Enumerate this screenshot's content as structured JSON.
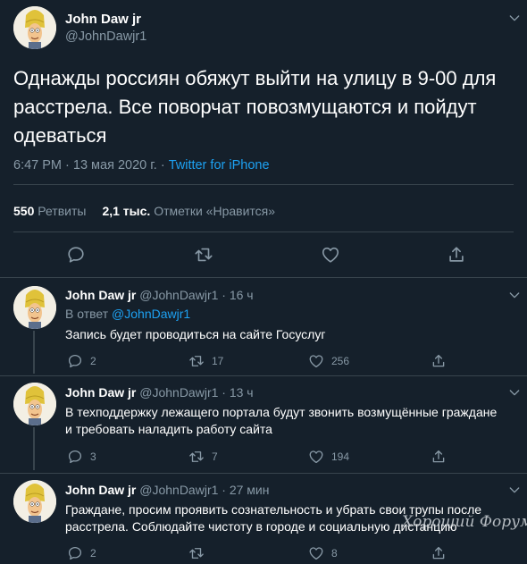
{
  "main": {
    "name": "John Daw jr",
    "handle": "@JohnDawjr1",
    "text": "Однажды россиян обяжут выйти на улицу в 9-00 для расстрела. Все поворчат повозмущаются и пойдут одеваться",
    "time": "6:47 PM · 13 мая 2020 г. · ",
    "source": "Twitter for iPhone",
    "retweets_count": "550",
    "retweets_label": "Ретвиты",
    "likes_count": "2,1 тыс.",
    "likes_label": "Отметки «Нравится»"
  },
  "replies": [
    {
      "name": "John Daw jr",
      "meta": "@JohnDawjr1 · 16 ч",
      "reply_to_label": "В ответ",
      "reply_to_handle": "@JohnDawjr1",
      "text": "Запись будет проводиться на сайте Госуслуг",
      "replies": "2",
      "retweets": "17",
      "likes": "256"
    },
    {
      "name": "John Daw jr",
      "meta": "@JohnDawjr1 · 13 ч",
      "text": "В техподдержку лежащего портала будут звонить возмущённые граждане и требовать наладить работу сайта",
      "replies": "3",
      "retweets": "7",
      "likes": "194"
    },
    {
      "name": "John Daw jr",
      "meta": "@JohnDawjr1 · 27 мин",
      "text": "Граждане, просим проявить сознательность и убрать свои трупы после расстрела. Соблюдайте чистоту в городе и социальную дистанцию",
      "replies": "2",
      "retweets": "",
      "likes": "8"
    }
  ],
  "watermark": "Хороший Форум",
  "colors": {
    "background": "#15202b",
    "text": "#ffffff",
    "secondary": "#8899a6",
    "accent": "#1da1f2",
    "divider": "#38444d"
  },
  "icons": [
    "chevron-down-icon",
    "reply-icon",
    "retweet-icon",
    "like-icon",
    "share-icon"
  ]
}
